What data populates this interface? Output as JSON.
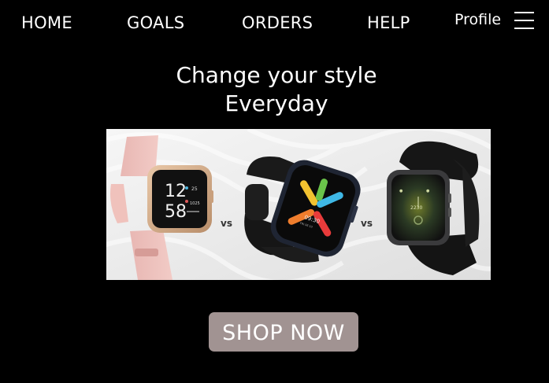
{
  "nav": {
    "home": "HOME",
    "goals": "GOALS",
    "orders": "ORDERS",
    "help": "HELP",
    "profile": "Profile",
    "menu_icon": "hamburger-menu-icon"
  },
  "hero": {
    "headline_line1": "Change your style",
    "headline_line2": "Everyday"
  },
  "banner": {
    "watch1": {
      "hours": "12",
      "minutes": "58",
      "date": "25",
      "steps": "1025"
    },
    "vs1": "vs",
    "watch2": {
      "time": "09:30",
      "date": "FRI 06 10"
    },
    "vs2": "vs",
    "watch3": {
      "time": "2230"
    }
  },
  "cta": {
    "label": "SHOP NOW"
  },
  "colors": {
    "background": "#000000",
    "text": "#ffffff",
    "cta_bg": "#a19392"
  }
}
